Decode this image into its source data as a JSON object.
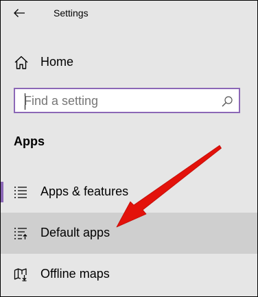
{
  "window": {
    "title": "Settings"
  },
  "nav": {
    "home_label": "Home"
  },
  "search": {
    "placeholder": "Find a setting",
    "value": ""
  },
  "section": {
    "title": "Apps"
  },
  "apps_items": [
    {
      "label": "Apps & features",
      "icon": "apps-features-icon",
      "active": true
    },
    {
      "label": "Default apps",
      "icon": "default-apps-icon",
      "hovered": true
    },
    {
      "label": "Offline maps",
      "icon": "offline-maps-icon"
    }
  ],
  "colors": {
    "accent": "#8b67b6",
    "background": "#e6e6e6",
    "hover": "#cfcfcf",
    "annotation_arrow": "#e3120b"
  }
}
